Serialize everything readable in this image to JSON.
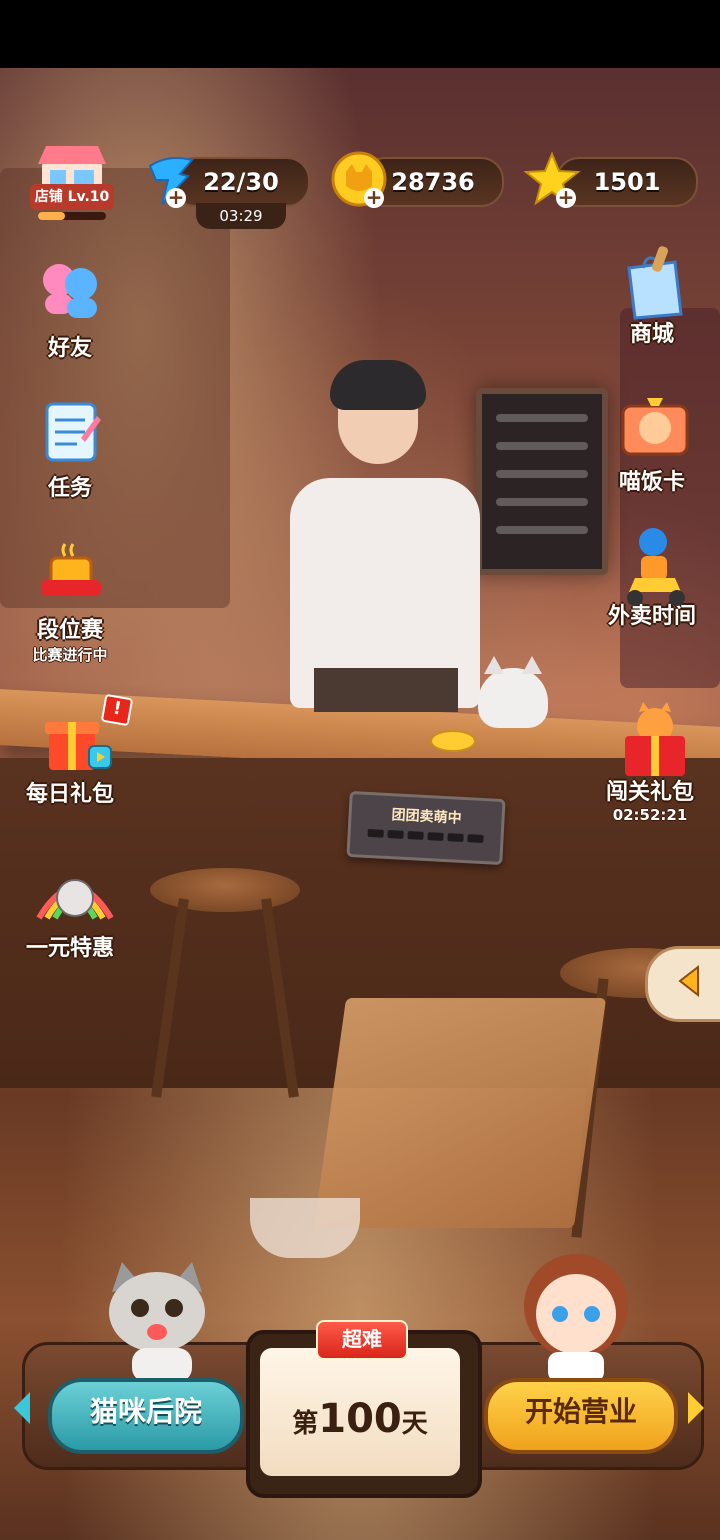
{
  "resources": {
    "shop_level": "店铺 Lv.10",
    "stamina": "22/30",
    "stamina_timer": "03:29",
    "coins": "28736",
    "stars": "1501"
  },
  "left_menu": [
    {
      "label": "好友"
    },
    {
      "label": "任务"
    },
    {
      "label": "段位赛",
      "sub": "比赛进行中"
    },
    {
      "label": "每日礼包"
    },
    {
      "label": "一元特惠"
    }
  ],
  "right_menu": [
    {
      "label": "商城"
    },
    {
      "label": "喵饭卡"
    },
    {
      "label": "外卖时间"
    },
    {
      "label": "闯关礼包",
      "sub": "02:52:21"
    }
  ],
  "scene": {
    "sign_text": "团团卖萌中"
  },
  "bottom": {
    "backyard_label": "猫咪后院",
    "difficulty": "超难",
    "day_prefix": "第",
    "day_number": "100",
    "day_suffix": "天",
    "start_label": "开始营业"
  },
  "colors": {
    "accent_gold": "#f0a21c",
    "teal_button": "#2a9aa6",
    "badge_red": "#d8261a"
  }
}
